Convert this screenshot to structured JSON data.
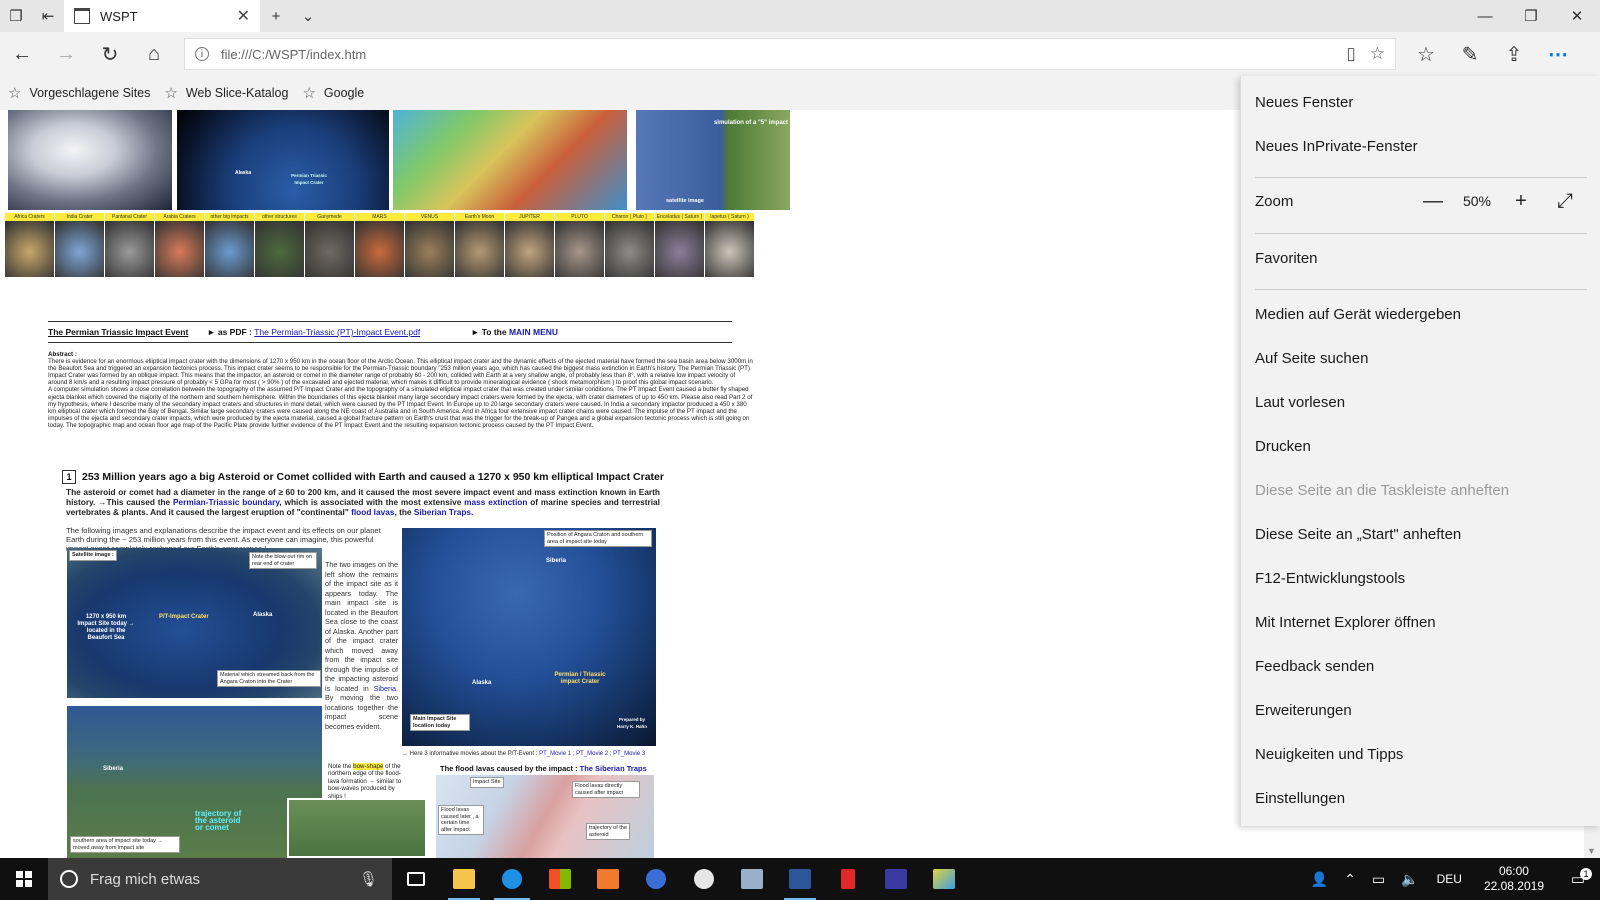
{
  "tab": {
    "title": "WSPT"
  },
  "address": {
    "url": "file:///C:/WSPT/index.htm"
  },
  "favorites": [
    {
      "label": "Vorgeschlagene Sites"
    },
    {
      "label": "Web Slice-Katalog"
    },
    {
      "label": "Google"
    }
  ],
  "page": {
    "banner": {
      "simulation_label": "simulation of a \"5\" impact",
      "siberia_label": "Siberia",
      "satellite_label": "satellite image",
      "alaska_label": "Alaska",
      "crater_label": "Permian Triassic Impact Crater"
    },
    "thumbs": [
      {
        "label": "Africa Craters",
        "color": "#c9a86a"
      },
      {
        "label": "India Crater",
        "color": "#7fa6d6"
      },
      {
        "label": "Pantanal Crater",
        "color": "#9a9a9a"
      },
      {
        "label": "Arabia Craters",
        "color": "#d97a5a"
      },
      {
        "label": "other big impacts",
        "color": "#6b9bd1"
      },
      {
        "label": "other structures",
        "color": "#4d6b3d"
      },
      {
        "label": "Ganymede",
        "color": "#6f6a62"
      },
      {
        "label": "MARS",
        "color": "#c96a3a"
      },
      {
        "label": "VENUS",
        "color": "#9c7f5a"
      },
      {
        "label": "Earth's Moon",
        "color": "#b59a72"
      },
      {
        "label": "JUPITER",
        "color": "#c1a47d"
      },
      {
        "label": "PLUTO",
        "color": "#a8968a"
      },
      {
        "label": "Charon ( Pluto )",
        "color": "#8f8c8a"
      },
      {
        "label": "Enceladus ( Saturn )",
        "color": "#8c7f9a"
      },
      {
        "label": "Iapetus ( Saturn )",
        "color": "#cdc6b8"
      }
    ],
    "heading": {
      "title": "The Permian Triassic Impact Event",
      "pdf_prefix": "► as PDF :",
      "pdf_link": "The Permian-Triassic (PT)-Impact Event.pdf",
      "menu_prefix": "► To the",
      "menu_link": "MAIN MENU"
    },
    "abstract": {
      "label": "Abstract :",
      "text": "There is evidence for an enormous elliptical impact crater with the dimensions of 1270 x 950 km in the ocean floor of the Arctic Ocean. This elliptical impact crater and the dynamic effects of the ejected material have formed the sea basin area below 3000m in the Beaufort Sea and triggered an expansion tectonics process. This impact crater seems to be responsible for the Permian-Triassic boundary \"253 million years ago, which has caused the biggest mass extinction in Earth's history. The Permian Triassic (PT) Impact Crater was formed by an oblique impact. This means that the impactor, an asteroid or comet in the diameter range of probably 60 - 200 km, collided with Earth at a very shallow angle, of probably less than 8°, with a relative low impact velocity of around 8 km/s and a resulting impact pressure of probably < 5 GPa for most ( > 90% ) of the excavated and ejected material, which makes it difficult to provide mineralogical evidence ( shock metamorphism ) to proof this global impact scenario.",
      "text2": "A computer simulation shows a close correlation between the topography of the assumed P/T Impact Crater and the topography of a simulated elliptical impact crater that was created under similar conditions. The PT Impact Event caused a butter fly shaped ejecta blanket which covered the majority of the northern and southern hemisphere. Within the boundaries of this ejecta blanket many large secondary impact craters were formed by the ejecta, with crater diameters of up to 450 km. Please also read Part 2 of my hypothesis, where I describe many of the secondary impact craters and structures in more detail, which were caused by the PT Impact Event. In Europe up to 20 large secondary craters were caused. In India a secondary impactor produced a 450 x 380 km elliptical crater which formed the Bay of Bengal. Similar large secondary craters were caused along the NE coast of Australia and in South America. And in Africa four extensive impact crater chains were caused. The impulse of the PT impact and the impulses of the ejecta and secondary crater impacts, which were produced by the ejecta material, caused a global fracture pattern on Earth's crust that was the trigger for the break-up of Pangea and a global expansion tectonic process which is still going on today. The topographic map and ocean floor age map of the Pacific Plate provide further evidence of the PT Impact Event and the resulting expansion tectonic process caused by the PT Impact Event."
    },
    "section1": {
      "num": "1",
      "title": "253 Million years ago a big Asteroid or Comet collided with Earth and caused a 1270 x 950 km elliptical Impact Crater",
      "intro_a": "The asteroid or comet had a diameter in the range of ≥ 60 to 200 km, and it caused the most severe impact event and mass extinction known in Earth history. →This caused the",
      "intro_link1": "Permian-Triassic boundary",
      "intro_b": ", which is associated with the most extensive",
      "intro_link2": "mass extinction",
      "intro_c": "of marine species and terrestrial vertebrates & plants. And it caused the largest eruption of \"continental\"",
      "intro_link3": "flood lavas",
      "intro_d": ", the",
      "intro_link4": "Siberian Traps.",
      "small": "The following images and explanations describe the impact event and its effects on our planet Earth during the ~ 253 million years from this event. As everyone can imagine, this powerful impact event completely reshaped our Earth's appearance !",
      "col_text": "The two images on the left show the remains of the impact site as it appears today. The main impact site is located in the Beaufort Sea close to the coast of Alaska. Another part of the impact crater which moved away from the impact site through the impulse of the impacting asteroid is located in",
      "col_link": "Siberia",
      "col_text2": ". By moving the two locations together the impact scene becomes evident."
    },
    "captions": {
      "satellite": "Satellite image :",
      "blowout": "Note the blow-out rim on rear end of crater",
      "size": "1270 x 950 km Impact Site today → located in the Beaufort Sea",
      "pt_crater": "P/T-Impact Crater",
      "alaska": "Alaska",
      "material": "Material which streamed back from the Angara Craton into the Crater",
      "position": "Position of Angara Craton and southern area of impact site today",
      "siberia": "Siberia",
      "alaska2": "Alaska",
      "pt_crater2": "Permian / Triassic impact Crater",
      "main_site": "Main Impact Site location today",
      "prepared": "Prepared by Harry K. Hahn",
      "movies_prefix": "→ Here 3 informative movies about the P/T-Event :",
      "movie1": "PT_Movie 1",
      "movie2": "PT_Movie 2",
      "movie3": "PT_Movie 3",
      "siberia3": "Siberia",
      "trajectory": "trajectory of the asteroid or comet",
      "southern": "southern area of impact site today → moved away from impact site",
      "note_a": "Note the",
      "note_hl": "bow-shape",
      "note_b": "of the northern edge of the flood-lava formation → similar to bow-waves produced by ships !",
      "flood_title_a": "The flood lavas caused by the impact :",
      "flood_title_b": "The Siberian Traps",
      "impact_site": "Impact Site",
      "flood_direct": "Flood lavas directly caused after impact",
      "flood_later": "Flood lavas caused later , a certain time after impact",
      "trajectory2": "trajectory of the asteroid"
    }
  },
  "menu": {
    "new_window": "Neues Fenster",
    "new_private": "Neues InPrivate-Fenster",
    "zoom_label": "Zoom",
    "zoom_value": "50%",
    "favorites": "Favoriten",
    "cast": "Medien auf Gerät wiedergeben",
    "find": "Auf Seite suchen",
    "read_aloud": "Laut vorlesen",
    "print": "Drucken",
    "pin_taskbar": "Diese Seite an die Taskleiste anheften",
    "pin_start": "Diese Seite an „Start\" anheften",
    "devtools": "F12-Entwicklungstools",
    "open_ie": "Mit Internet Explorer öffnen",
    "feedback": "Feedback senden",
    "extensions": "Erweiterungen",
    "news": "Neuigkeiten und Tipps",
    "settings": "Einstellungen"
  },
  "taskbar": {
    "search_placeholder": "Frag mich etwas",
    "lang": "DEU",
    "time": "06:00",
    "date": "22.08.2019",
    "notif_count": "1"
  }
}
